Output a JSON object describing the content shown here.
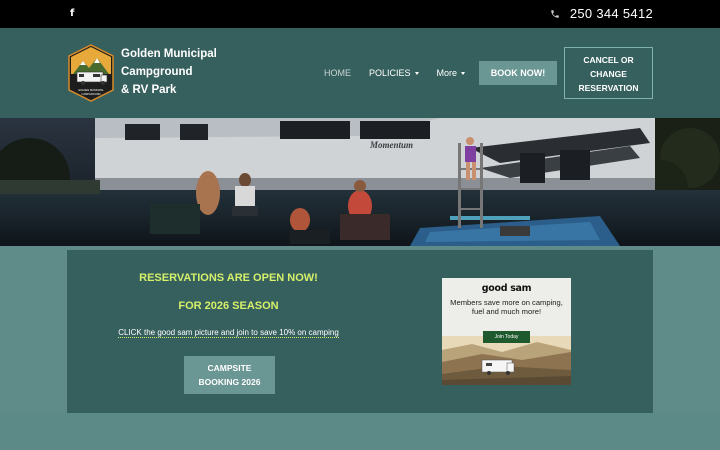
{
  "topbar": {
    "facebook_icon": "f",
    "phone_icon": "phone-icon",
    "phone_number": "250 344 5412"
  },
  "brand": {
    "line1": "Golden Municipal",
    "line2": "Campground",
    "line3": "& RV Park",
    "logo_text_top": "GOLDEN MUNICIPAL",
    "logo_text_bottom": "CAMPGROUND"
  },
  "nav": {
    "home": "HOME",
    "policies": "POLICIES",
    "more": "More"
  },
  "header_buttons": {
    "book": "BOOK NOW!",
    "cancel_line1": "CANCEL OR",
    "cancel_line2": "CHANGE",
    "cancel_line3": "RESERVATION"
  },
  "hero": {
    "rv_brand_text": "Momentum"
  },
  "panel": {
    "headline1": "RESERVATIONS ARE OPEN NOW!",
    "headline2": "FOR 2026 SEASON",
    "click_text": "CLICK the good sam picture and join to save 10% on camping",
    "campsite_line1": "CAMPSITE",
    "campsite_line2": "BOOKING 2026"
  },
  "ad": {
    "brand": "good sam",
    "text": "Members save more on camping, fuel and much more!",
    "button": "Join Today"
  },
  "colors": {
    "topbar": "#000000",
    "header": "#36605e",
    "page": "#5f8c89",
    "accent_button": "#6a9694",
    "headline": "#d6f06a"
  }
}
